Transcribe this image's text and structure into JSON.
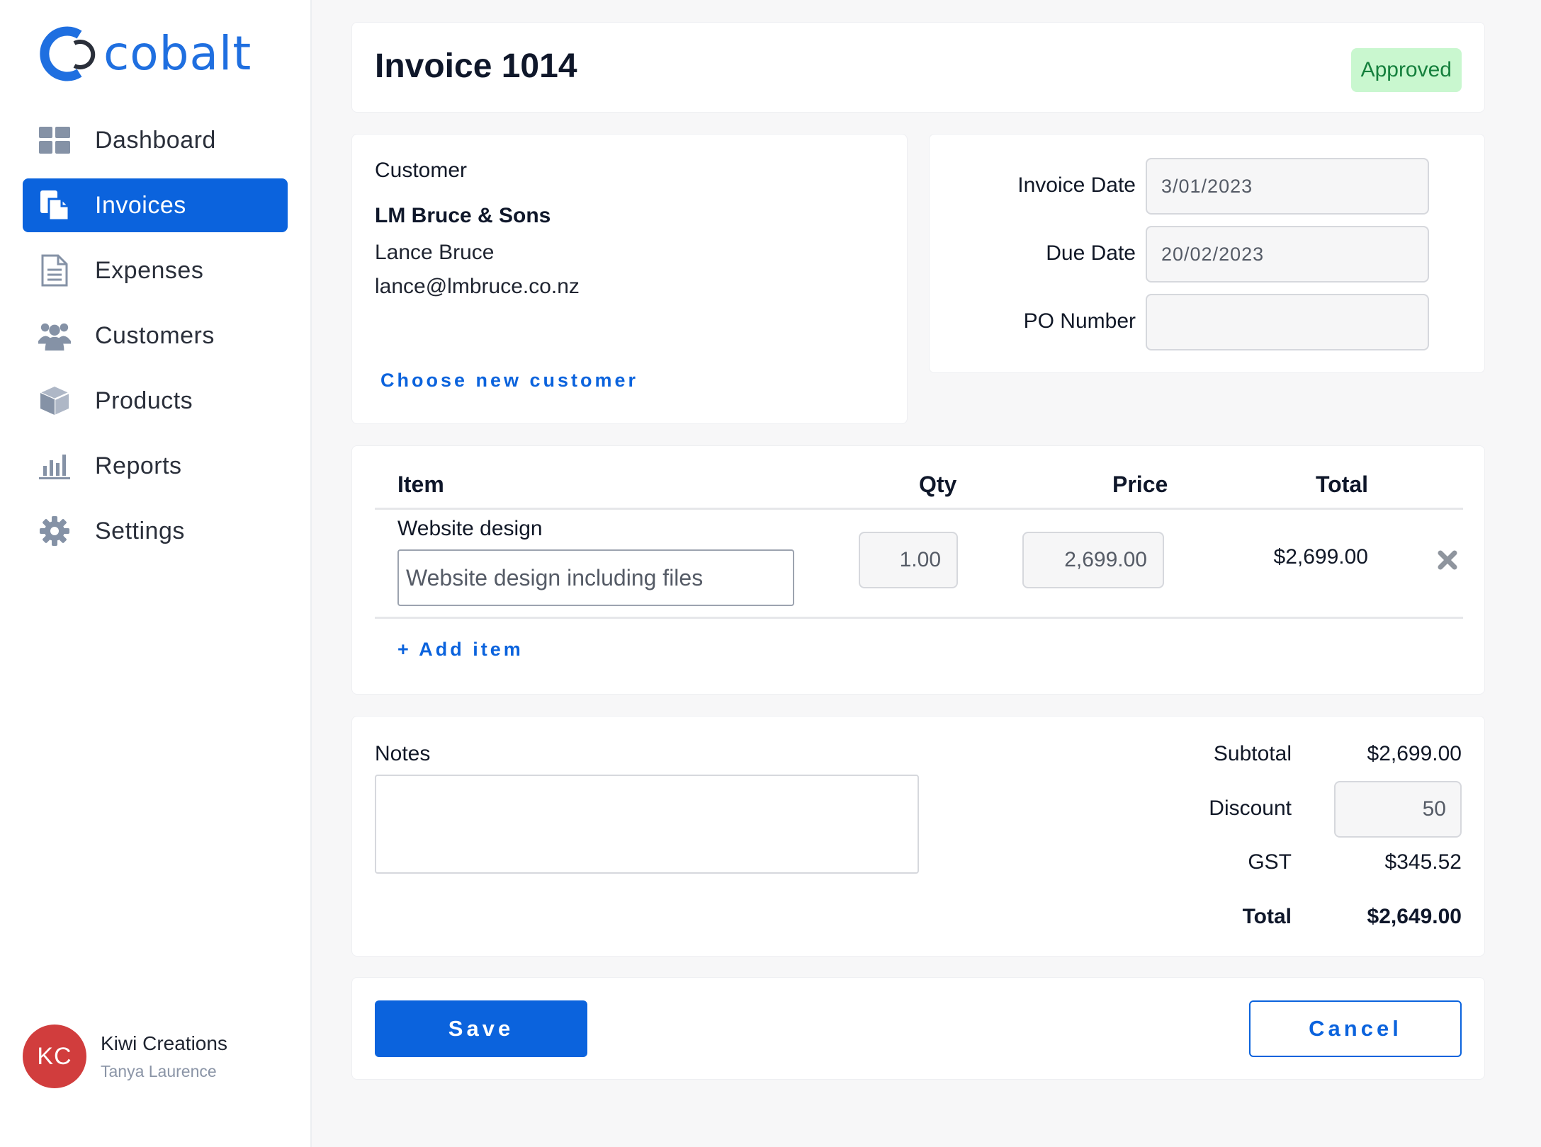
{
  "brand": {
    "name": "cobalt",
    "accent": "#0b63dd"
  },
  "sidebar": {
    "items": [
      {
        "label": "Dashboard",
        "icon": "dashboard-icon",
        "active": false
      },
      {
        "label": "Invoices",
        "icon": "invoice-icon",
        "active": true
      },
      {
        "label": "Expenses",
        "icon": "document-icon",
        "active": false
      },
      {
        "label": "Customers",
        "icon": "users-icon",
        "active": false
      },
      {
        "label": "Products",
        "icon": "box-icon",
        "active": false
      },
      {
        "label": "Reports",
        "icon": "bar-chart-icon",
        "active": false
      },
      {
        "label": "Settings",
        "icon": "gear-icon",
        "active": false
      }
    ],
    "user": {
      "initials": "KC",
      "org": "Kiwi Creations",
      "name": "Tanya Laurence"
    }
  },
  "header": {
    "title": "Invoice 1014",
    "status": "Approved",
    "status_color": "#15803d"
  },
  "customer": {
    "label": "Customer",
    "company": "LM Bruce & Sons",
    "contact": "Lance Bruce",
    "email": "lance@lmbruce.co.nz",
    "change_link": "Choose new customer"
  },
  "details": {
    "invoice_date": {
      "label": "Invoice Date",
      "value": "3/01/2023"
    },
    "due_date": {
      "label": "Due Date",
      "value": "20/02/2023"
    },
    "po_number": {
      "label": "PO Number",
      "value": ""
    }
  },
  "items": {
    "headers": {
      "item": "Item",
      "qty": "Qty",
      "price": "Price",
      "total": "Total"
    },
    "rows": [
      {
        "name": "Website design",
        "description": "Website design including files",
        "qty": "1.00",
        "price": "2,699.00",
        "total": "$2,699.00"
      }
    ],
    "add_label": "+ Add item"
  },
  "summary": {
    "notes_label": "Notes",
    "notes_value": "",
    "subtotal_label": "Subtotal",
    "subtotal": "$2,699.00",
    "discount_label": "Discount",
    "discount": "50",
    "gst_label": "GST",
    "gst": "$345.52",
    "total_label": "Total",
    "total": "$2,649.00"
  },
  "actions": {
    "save": "Save",
    "cancel": "Cancel"
  }
}
